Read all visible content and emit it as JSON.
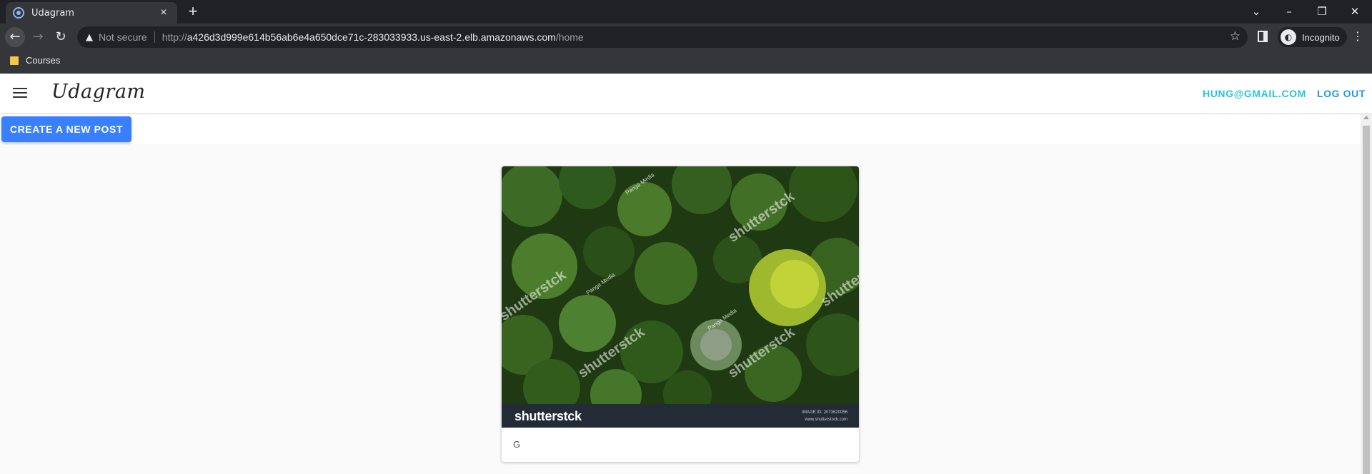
{
  "browser": {
    "tab_title": "Udagram",
    "tab_close": "×",
    "new_tab": "+",
    "not_secure": "Not secure",
    "url_scheme": "http://",
    "url_host": "a426d3d999e614b56ab6e4a650dce71c-283033933.us-east-2.elb.amazonaws.com",
    "url_path": "/home",
    "incognito_label": "Incognito",
    "bookmark_label": "Courses"
  },
  "app": {
    "brand": "Udagram",
    "user_email": "HUNG@GMAIL.COM",
    "logout_label": "LOG OUT",
    "create_post_label": "CREATE A NEW POST"
  },
  "post": {
    "caption": "G",
    "watermark_logo": "shutterstck",
    "watermark_image_id": "IMAGE ID: 2073620056",
    "watermark_site": "www.shutterstock.com",
    "watermark_repeat": "shutterstck",
    "watermark_credit": "Panga Media"
  },
  "colors": {
    "accent_button": "#3880ff",
    "user_link": "#26c6da",
    "logout_link": "#2196f3"
  }
}
